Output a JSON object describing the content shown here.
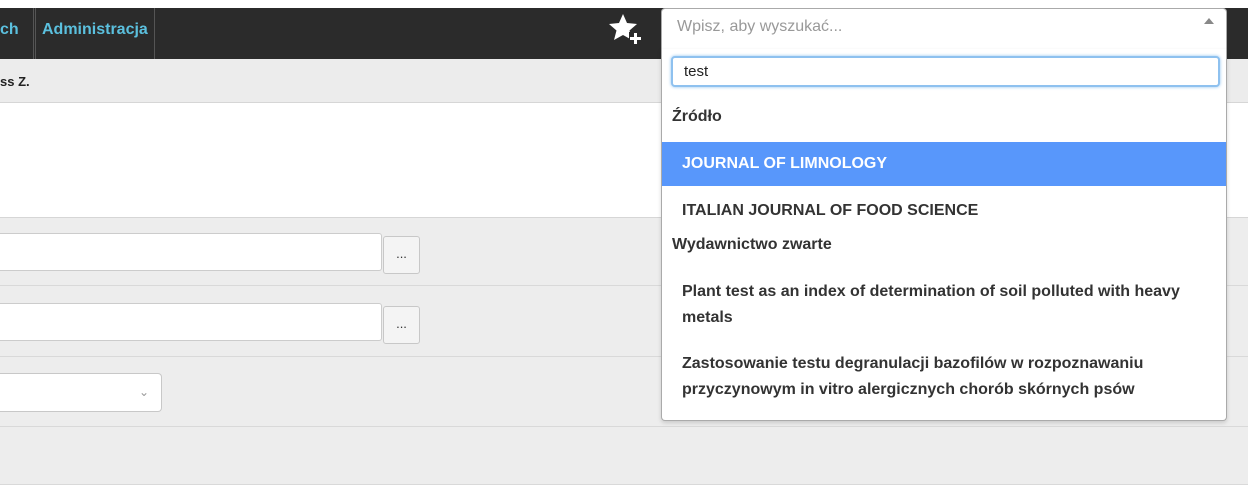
{
  "nav": {
    "item_cut": "ch",
    "item_admin": "Administracja"
  },
  "user": {
    "name_fragment": "ss Z."
  },
  "form": {
    "browse_button_1": "...",
    "browse_button_2": "..."
  },
  "search": {
    "placeholder": "Wpisz, aby wyszukać...",
    "query": "test",
    "groups": [
      {
        "label": "Źródło",
        "options": [
          "JOURNAL OF LIMNOLOGY",
          "ITALIAN JOURNAL OF FOOD SCIENCE"
        ]
      },
      {
        "label": "Wydawnictwo zwarte",
        "options": [
          "Plant test as an index of determination of soil polluted with heavy metals",
          "Zastosowanie testu degranulacji bazofilów w rozpoznawaniu przyczynowym in vitro alergicznych chorób skórnych psów"
        ]
      }
    ],
    "highlighted_option": "JOURNAL OF LIMNOLOGY"
  },
  "colors": {
    "nav_bg": "#2b2b2b",
    "nav_link": "#5bc0de",
    "highlight": "#5897fb"
  }
}
